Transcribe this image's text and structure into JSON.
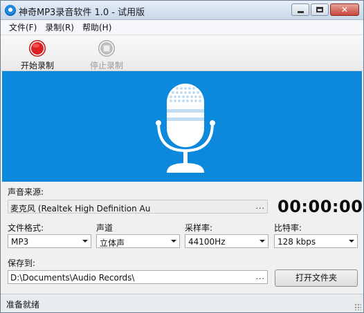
{
  "window": {
    "title": "神奇MP3录音软件 1.0 - 试用版"
  },
  "menu": {
    "items": [
      {
        "label": "文件(F)"
      },
      {
        "label": "录制(R)"
      },
      {
        "label": "帮助(H)"
      }
    ]
  },
  "toolbar": {
    "start_label": "开始录制",
    "stop_label": "停止录制",
    "start_color": "#e02020",
    "stop_enabled": false
  },
  "banner": {
    "color": "#0c88dc",
    "icon": "microphone-icon"
  },
  "source": {
    "label": "声音来源:",
    "value": "麦克风 (Realtek High Definition Au",
    "browse": "..."
  },
  "timer": {
    "value": "00:00:00"
  },
  "format": {
    "label": "文件格式:",
    "value": "MP3"
  },
  "channel": {
    "label": "声道",
    "value": "立体声"
  },
  "samplerate": {
    "label": "采样率:",
    "value": "44100Hz"
  },
  "bitrate": {
    "label": "比特率:",
    "value": "128 kbps"
  },
  "save": {
    "label": "保存到:",
    "path": "D:\\Documents\\Audio Records\\",
    "browse": "...",
    "open_folder": "打开文件夹"
  },
  "status": {
    "text": "准备就绪"
  }
}
